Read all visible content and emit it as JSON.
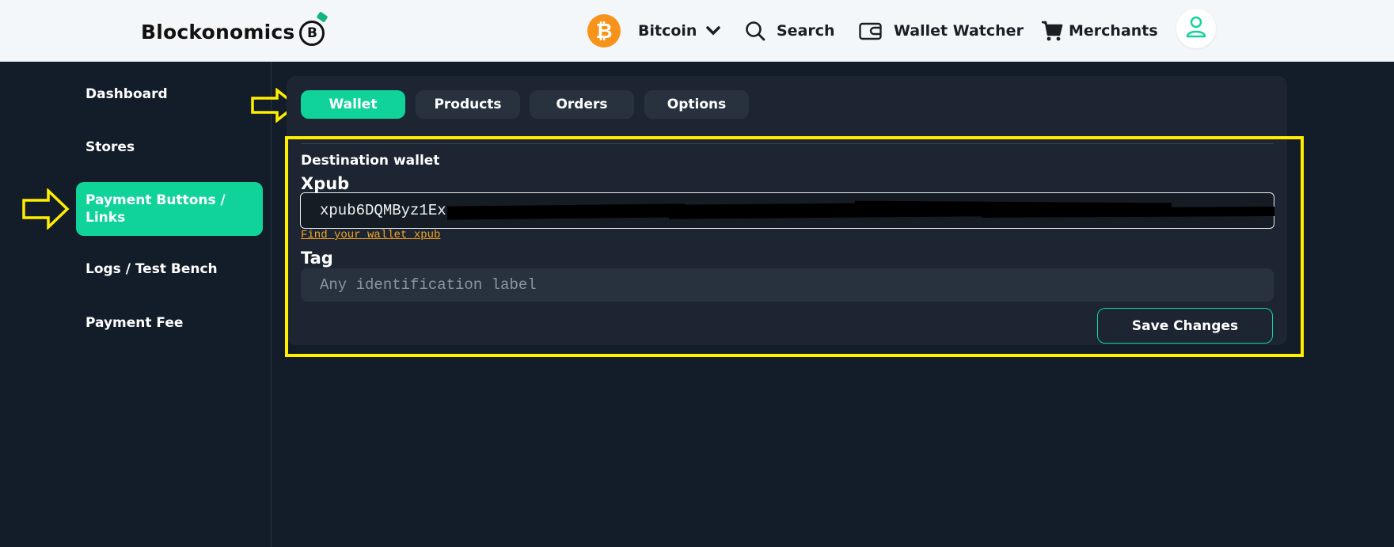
{
  "header": {
    "brand_name": "Blockonomics",
    "brand_logo_letter": "B",
    "currency": {
      "label": "Bitcoin",
      "coin_symbol": "₿",
      "icon": "bitcoin-icon"
    },
    "nav": {
      "search": "Search",
      "wallet_watcher": "Wallet Watcher",
      "merchants": "Merchants"
    },
    "icons": [
      "chevron-down-icon",
      "search-icon",
      "wallet-icon",
      "cart-icon",
      "user-icon"
    ]
  },
  "sidebar": {
    "items": [
      {
        "label": "Dashboard",
        "active": false
      },
      {
        "label": "Stores",
        "active": false
      },
      {
        "label": "Payment Buttons / Links",
        "active": true
      },
      {
        "label": "Logs / Test Bench",
        "active": false
      },
      {
        "label": "Payment Fee",
        "active": false
      }
    ]
  },
  "tabs": [
    {
      "label": "Wallet",
      "active": true
    },
    {
      "label": "Products",
      "active": false
    },
    {
      "label": "Orders",
      "active": false
    },
    {
      "label": "Options",
      "active": false
    }
  ],
  "form": {
    "section_title": "Destination wallet",
    "xpub_label": "Xpub",
    "xpub_value": "xpub6DQMByz1Ex",
    "find_link": "Find your wallet xpub",
    "tag_label": "Tag",
    "tag_placeholder": "Any identification label",
    "tag_value": "",
    "save_label": "Save Changes"
  },
  "colors": {
    "accent": "#10d39a",
    "background": "#131d29",
    "panel": "#1c2531",
    "header_bg": "#f4f7f9",
    "bitcoin": "#f7931a",
    "link": "#f5a623",
    "annotation": "#ffee00"
  }
}
